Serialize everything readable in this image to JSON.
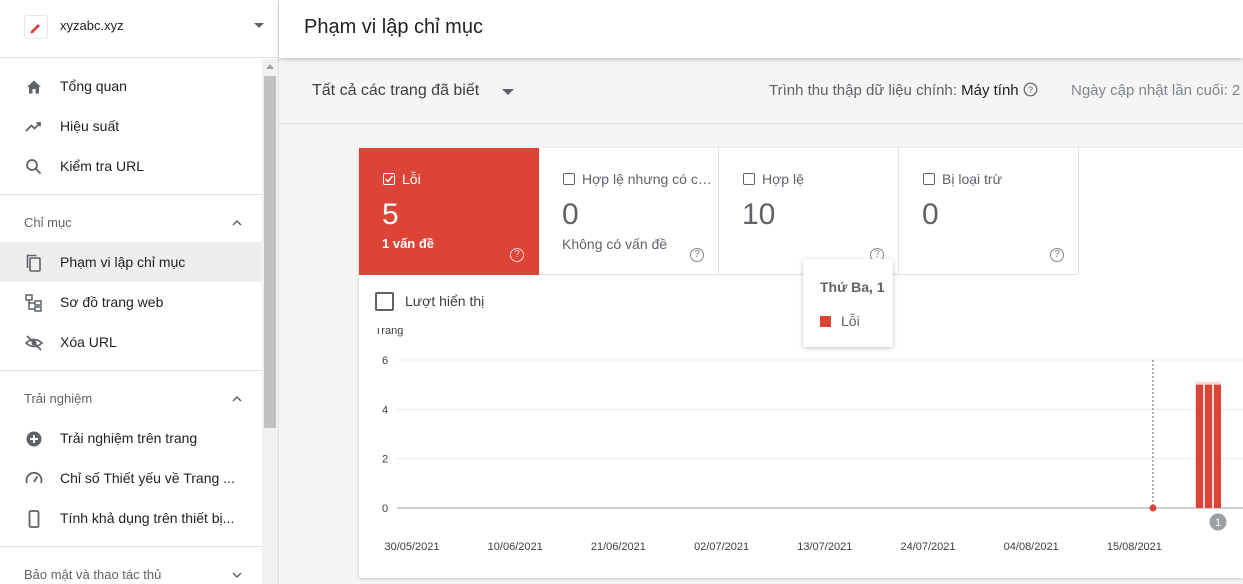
{
  "property": {
    "name": "xyzabc.xyz"
  },
  "sidebar": {
    "top_items": [
      {
        "label": "Tổng quan",
        "icon": "home-icon"
      },
      {
        "label": "Hiệu suất",
        "icon": "trending-up-icon"
      },
      {
        "label": "Kiểm tra URL",
        "icon": "search-icon"
      }
    ],
    "sections": [
      {
        "title": "Chỉ mục",
        "items": [
          {
            "label": "Phạm vi lập chỉ mục",
            "icon": "coverage-icon",
            "active": true
          },
          {
            "label": "Sơ đồ trang web",
            "icon": "sitemap-icon"
          },
          {
            "label": "Xóa URL",
            "icon": "eye-off-icon"
          }
        ]
      },
      {
        "title": "Trải nghiệm",
        "items": [
          {
            "label": "Trải nghiệm trên trang",
            "icon": "page-experience-icon"
          },
          {
            "label": "Chỉ số Thiết yếu về Trang ...",
            "icon": "gauge-icon"
          },
          {
            "label": "Tính khả dụng trên thiết bị...",
            "icon": "mobile-icon"
          }
        ]
      },
      {
        "title": "Bảo mật và thao tác thủ",
        "items": []
      }
    ]
  },
  "header": {
    "title": "Phạm vi lập chỉ mục"
  },
  "filter": {
    "selected": "Tất cả các trang đã biết",
    "crawler_label": "Trình thu thập dữ liệu chính:",
    "crawler_value": "Máy tính",
    "updated_label": "Ngày cập nhật lần cuối: 2"
  },
  "tiles": [
    {
      "label": "Lỗi",
      "value": "5",
      "sub": "1 vấn đề",
      "checked": true,
      "color": "#db4437"
    },
    {
      "label": "Hợp lệ nhưng có cảnh báo",
      "value": "0",
      "sub": "Không có vấn đề",
      "checked": false
    },
    {
      "label": "Hợp lệ",
      "value": "10",
      "sub": "",
      "checked": false
    },
    {
      "label": "Bị loại trừ",
      "value": "0",
      "sub": "",
      "checked": false
    }
  ],
  "impressions_label": "Lượt hiển thị",
  "chart_data": {
    "type": "bar",
    "ylabel": "Trang",
    "ylim": [
      0,
      6
    ],
    "y_ticks": [
      "0",
      "2",
      "4",
      "6"
    ],
    "x_tick_labels": [
      "30/05/2021",
      "10/06/2021",
      "21/06/2021",
      "02/07/2021",
      "13/07/2021",
      "24/07/2021",
      "04/08/2021",
      "15/08/2021"
    ],
    "series": [
      {
        "name": "Lỗi",
        "color": "#db4437",
        "values": [
          0,
          5,
          5,
          5
        ]
      }
    ],
    "notes": [
      "1"
    ]
  },
  "tooltip": {
    "date": "Thứ Ba, 1",
    "series_label": "Lỗi"
  }
}
